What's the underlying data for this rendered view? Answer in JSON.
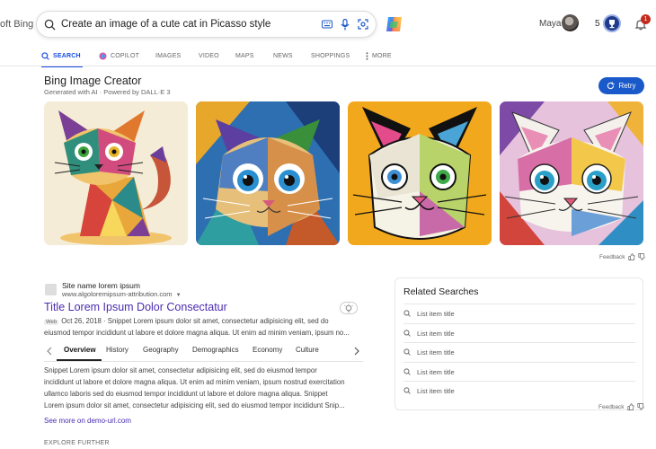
{
  "header": {
    "brand_fragment": "oft Bing",
    "search_query": "Create an image of a cute cat in Picasso style",
    "user_name": "Maya",
    "reward_points": "5",
    "notification_count": "1"
  },
  "nav": {
    "tabs": [
      {
        "label": "SEARCH",
        "icon": "search-icon",
        "active": true
      },
      {
        "label": "COPILOT",
        "icon": "copilot-icon",
        "active": false
      },
      {
        "label": "IMAGES",
        "active": false
      },
      {
        "label": "VIDEO",
        "active": false
      },
      {
        "label": "MAPS",
        "active": false
      },
      {
        "label": "NEWS",
        "active": false
      },
      {
        "label": "SHOPPINGS",
        "active": false
      },
      {
        "label": "MORE",
        "icon": "more-vertical-icon",
        "active": false
      }
    ]
  },
  "image_creator": {
    "title": "Bing Image Creator",
    "subtitle": "Generated with AI · Powered by DALL·E 3",
    "retry_label": "Retry",
    "feedback_label": "Feedback",
    "images": [
      {
        "alt": "cubist cat sitting",
        "bg": "#f4ecd6"
      },
      {
        "alt": "cubist cat face blue",
        "bg": "#2d6fb0"
      },
      {
        "alt": "cubist cat face yellow",
        "bg": "#f2a81d"
      },
      {
        "alt": "cubist cat face colorful",
        "bg": "#e6c2dc"
      }
    ]
  },
  "result": {
    "site_name": "Site name lorem ipsum",
    "site_url": "www.algoloremipsum-attribution.com",
    "title": "Title Lorem Ipsum Dolor Consectatur",
    "web_tag": "Web",
    "snippet_line1": "Oct 26, 2018 · Snippet Lorem ipsum dolor sit amet, consectetur adipisicing elit, sed do",
    "snippet_line2": "eiusmod tempor incididunt ut labore et dolore magna aliqua. Ut enim ad minim veniam, ipsum no...",
    "deep_tabs": [
      "Overview",
      "History",
      "Geography",
      "Demographics",
      "Economy",
      "Culture"
    ],
    "body_lines": [
      "Snippet Lorem ipsum dolor sit amet, consectetur adipisicing elit, sed do eiusmod tempor",
      "incididunt ut labore et dolore magna aliqua. Ut enim ad minim veniam, ipsum nostrud exercitation",
      "ullamco laboris sed do eiusmod tempor incididunt ut labore et dolore magna aliqua. Snippet",
      "Lorem ipsum dolor sit amet, consectetur adipisicing elit, sed do eiusmod tempor incididunt Snip..."
    ],
    "more_link": "See more on demo-url.com",
    "explore_label": "EXPLORE FURTHER"
  },
  "related": {
    "title": "Related Searches",
    "items": [
      "List item title",
      "List item title",
      "List item title",
      "List item title",
      "List item title"
    ],
    "feedback_label": "Feedback"
  }
}
